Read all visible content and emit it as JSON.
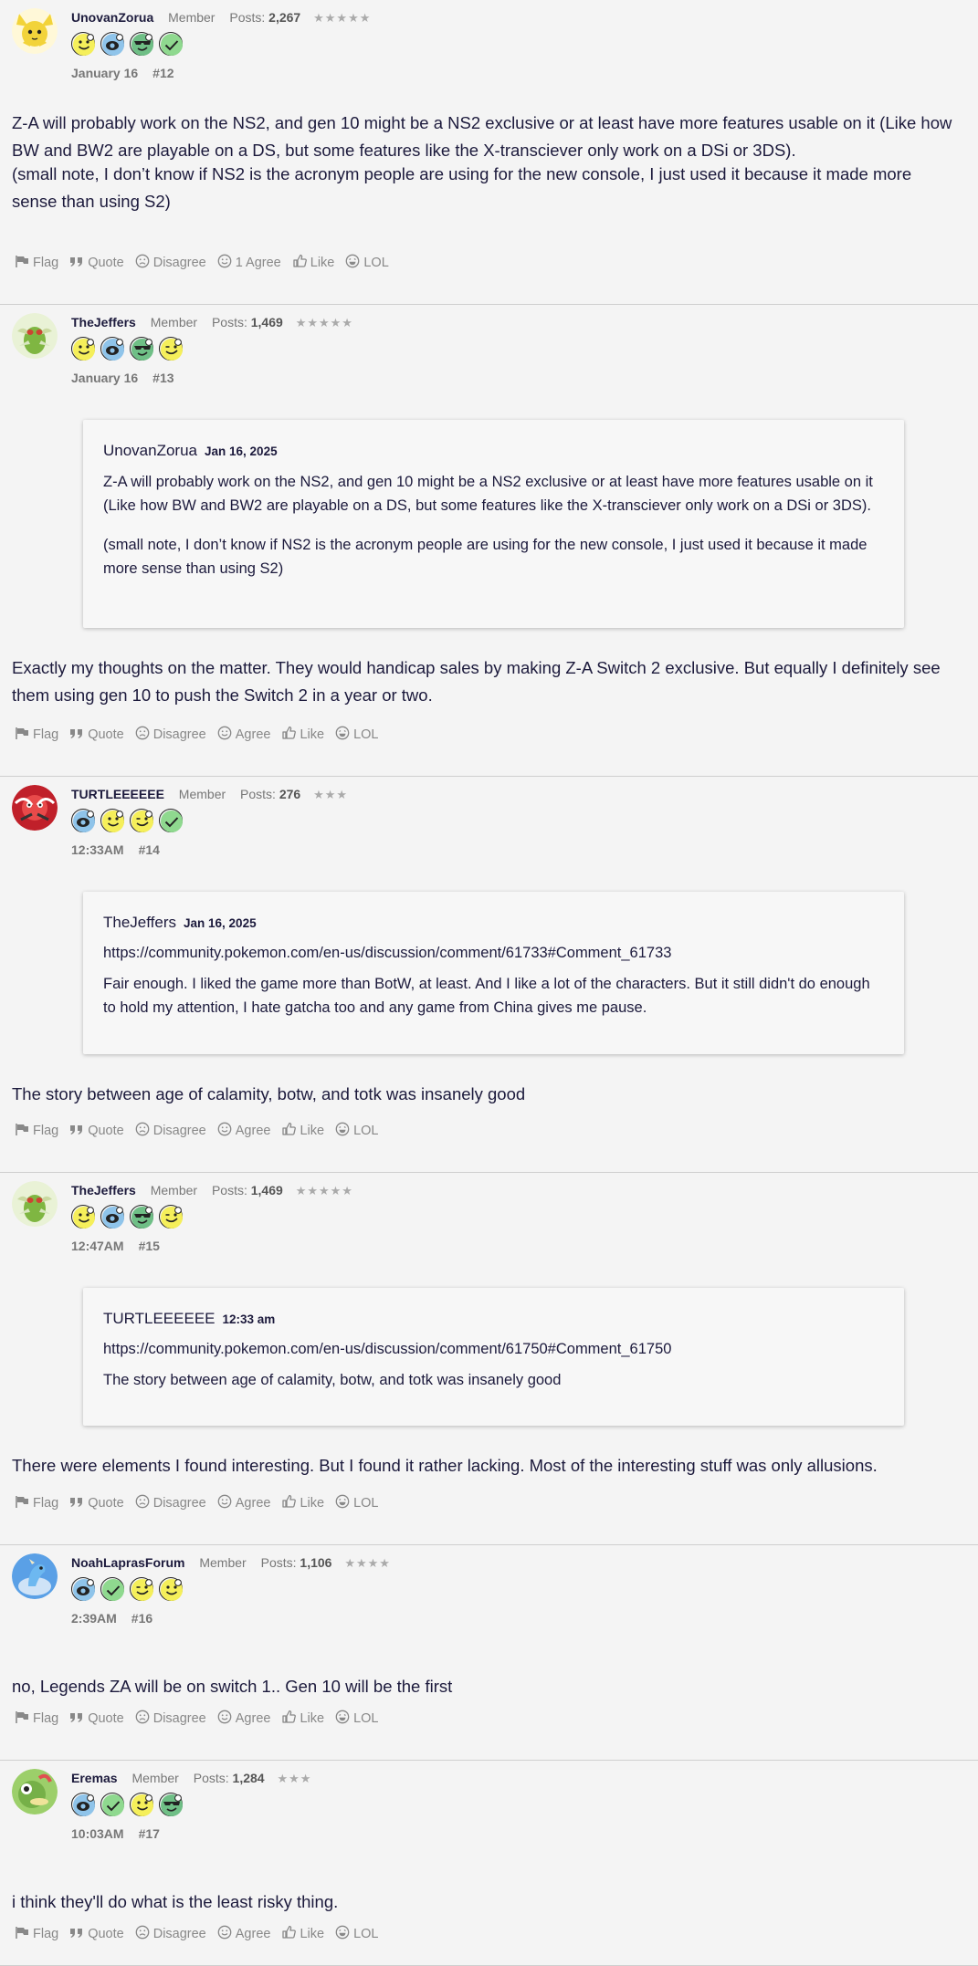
{
  "posts": [
    {
      "user": "UnovanZorua",
      "role": "Member",
      "posts_label": "Posts:",
      "post_count": "2,267",
      "stars": "★★★★★",
      "avatar": "zorua-avatar",
      "badges": [
        "smiley-badge",
        "camera-badge",
        "sunglasses-badge",
        "check-badge"
      ],
      "date": "January 16",
      "number": "#12",
      "quote": null,
      "paragraphs": [
        "Z-A will probably work on the NS2, and gen 10 might be a NS2 exclusive or at least have more features usable on it (Like how BW and BW2 are playable on a DS, but some features like the X-transciever only work on a DSi or 3DS).",
        "(small note, I don’t know if NS2 is the acronym people are using for the new console, I just used it because it made more sense than using S2)"
      ],
      "actions": {
        "flag": "Flag",
        "quote": "Quote",
        "disagree": "Disagree",
        "agree": "1 Agree",
        "like": "Like",
        "lol": "LOL"
      }
    },
    {
      "user": "TheJeffers",
      "role": "Member",
      "posts_label": "Posts:",
      "post_count": "1,469",
      "stars": "★★★★★",
      "avatar": "scyther-avatar",
      "badges": [
        "smiley-badge",
        "camera-badge",
        "sunglasses-badge",
        "wink-badge"
      ],
      "date": "January 16",
      "number": "#13",
      "quote": {
        "author": "UnovanZorua",
        "date": "Jan 16, 2025",
        "link": null,
        "paragraphs": [
          "Z-A will probably work on the NS2, and gen 10 might be a NS2 exclusive or at least have more features usable on it (Like how BW and BW2 are playable on a DS, but some features like the X-transciever only work on a DSi or 3DS).",
          "(small note, I don’t know if NS2 is the acronym people are using for the new console, I just used it because it made more sense than using S2)"
        ]
      },
      "paragraphs": [
        "Exactly my thoughts on the matter. They would handicap sales by making Z-A Switch 2 exclusive. But equally I definitely see them using gen 10 to push the Switch 2 in a year or two."
      ],
      "actions": {
        "flag": "Flag",
        "quote": "Quote",
        "disagree": "Disagree",
        "agree": "Agree",
        "like": "Like",
        "lol": "LOL"
      }
    },
    {
      "user": "TURTLEEEEEE",
      "role": "Member",
      "posts_label": "Posts:",
      "post_count": "276",
      "stars": "★★★",
      "avatar": "scizor-avatar",
      "badges": [
        "camera-badge",
        "smiley-badge",
        "wink-badge",
        "check-badge"
      ],
      "date": "12:33AM",
      "number": "#14",
      "quote": {
        "author": "TheJeffers",
        "date": "Jan 16, 2025",
        "link": "https://community.pokemon.com/en-us/discussion/comment/61733#Comment_61733",
        "paragraphs": [
          "Fair enough. I liked the game more than BotW, at least. And I like a lot of the characters. But it still didn't do enough to hold my attention, I hate gatcha too and any game from China gives me pause."
        ]
      },
      "paragraphs": [
        "The story between age of calamity, botw, and totk was insanely good"
      ],
      "actions": {
        "flag": "Flag",
        "quote": "Quote",
        "disagree": "Disagree",
        "agree": "Agree",
        "like": "Like",
        "lol": "LOL"
      }
    },
    {
      "user": "TheJeffers",
      "role": "Member",
      "posts_label": "Posts:",
      "post_count": "1,469",
      "stars": "★★★★★",
      "avatar": "scyther-avatar",
      "badges": [
        "smiley-badge",
        "camera-badge",
        "sunglasses-badge",
        "wink-badge"
      ],
      "date": "12:47AM",
      "number": "#15",
      "quote": {
        "author": "TURTLEEEEEE",
        "date": "12:33 am",
        "link": "https://community.pokemon.com/en-us/discussion/comment/61750#Comment_61750",
        "paragraphs": [
          "The story between age of calamity, botw, and totk was insanely good"
        ]
      },
      "paragraphs": [
        "There were elements I found interesting. But I found it rather lacking. Most of the interesting stuff was only allusions."
      ],
      "actions": {
        "flag": "Flag",
        "quote": "Quote",
        "disagree": "Disagree",
        "agree": "Agree",
        "like": "Like",
        "lol": "LOL"
      }
    },
    {
      "user": "NoahLaprasForum",
      "role": "Member",
      "posts_label": "Posts:",
      "post_count": "1,106",
      "stars": "★★★★",
      "avatar": "lapras-avatar",
      "badges": [
        "camera-badge",
        "check-badge",
        "wink-badge",
        "smiley-badge"
      ],
      "date": "2:39AM",
      "number": "#16",
      "quote": null,
      "paragraphs": [
        "no, Legends ZA will be on switch 1.. Gen 10 will be the first"
      ],
      "actions": {
        "flag": "Flag",
        "quote": "Quote",
        "disagree": "Disagree",
        "agree": "Agree",
        "like": "Like",
        "lol": "LOL"
      }
    },
    {
      "user": "Eremas",
      "role": "Member",
      "posts_label": "Posts:",
      "post_count": "1,284",
      "stars": "★★★",
      "avatar": "caterpie-avatar",
      "badges": [
        "camera-badge",
        "check-badge",
        "smiley-badge",
        "sunglasses-badge"
      ],
      "date": "10:03AM",
      "number": "#17",
      "quote": null,
      "paragraphs": [
        "i think they'll do what is the least risky thing."
      ],
      "actions": {
        "flag": "Flag",
        "quote": "Quote",
        "disagree": "Disagree",
        "agree": "Agree",
        "like": "Like",
        "lol": "LOL"
      }
    }
  ]
}
